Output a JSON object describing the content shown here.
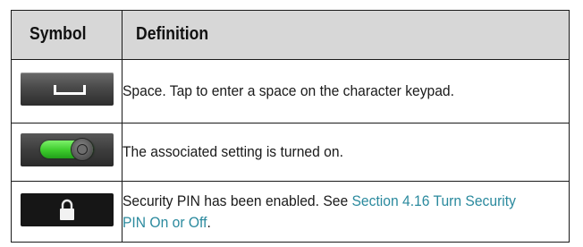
{
  "table": {
    "headers": [
      "Symbol",
      "Definition"
    ],
    "rows": [
      {
        "icon": "space-key-icon",
        "text": "Space. Tap to enter a space on the character keypad."
      },
      {
        "icon": "toggle-on-icon",
        "text": "The associated setting is turned on."
      },
      {
        "icon": "lock-icon",
        "text_before": "Security PIN has been enabled. See ",
        "link_text": "Section 4.16 Turn Security PIN On or Off",
        "text_after": "."
      }
    ]
  },
  "colors": {
    "header_bg": "#d7d7d7",
    "link": "#2b8a9e",
    "toggle_green": "#3ccb2c"
  }
}
